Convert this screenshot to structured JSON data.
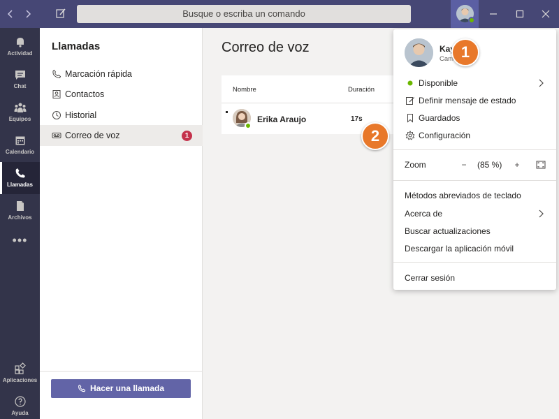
{
  "titlebar": {
    "search_placeholder": "Busque o escriba un comando",
    "back_icon": "chevron-left-icon",
    "forward_icon": "chevron-right-icon",
    "compose_icon": "compose-icon"
  },
  "rail": {
    "items": [
      {
        "label": "Actividad",
        "icon": "bell-icon"
      },
      {
        "label": "Chat",
        "icon": "chat-icon"
      },
      {
        "label": "Equipos",
        "icon": "teams-icon"
      },
      {
        "label": "Calendario",
        "icon": "calendar-icon"
      },
      {
        "label": "Llamadas",
        "icon": "phone-icon",
        "active": true
      },
      {
        "label": "Archivos",
        "icon": "file-icon"
      }
    ],
    "more": "•••",
    "apps_label": "Aplicaciones",
    "help_label": "Ayuda"
  },
  "panel": {
    "title": "Llamadas",
    "items": [
      {
        "label": "Marcación rápida",
        "icon": "phone-icon"
      },
      {
        "label": "Contactos",
        "icon": "contacts-icon"
      },
      {
        "label": "Historial",
        "icon": "clock-icon"
      },
      {
        "label": "Correo de voz",
        "icon": "voicemail-icon",
        "badge": "1",
        "selected": true
      }
    ],
    "call_button": "Hacer una llamada"
  },
  "main": {
    "title": "Correo de voz",
    "columns": [
      "Nombre",
      "Duración"
    ],
    "rows": [
      {
        "name": "Erika Araujo",
        "duration": "17s",
        "status": "available"
      }
    ]
  },
  "profile_menu": {
    "name": "Kay   pool",
    "subtitle": "Cam         agen",
    "status": "Disponible",
    "status_color": "#6bb700",
    "items_top": [
      {
        "label": "Definir mensaje de estado",
        "icon": "edit-icon"
      },
      {
        "label": "Guardados",
        "icon": "bookmark-icon"
      },
      {
        "label": "Configuración",
        "icon": "gear-icon"
      }
    ],
    "zoom_label": "Zoom",
    "zoom_minus": "−",
    "zoom_value": "(85 %)",
    "zoom_plus": "+",
    "items_bottom": [
      "Métodos abreviados de teclado",
      "Acerca de",
      "Buscar actualizaciones",
      "Descargar la aplicación móvil"
    ],
    "signout": "Cerrar sesión"
  },
  "callouts": [
    "1",
    "2"
  ],
  "colors": {
    "titlebar": "#464775",
    "rail": "#33344a",
    "accent": "#6264a7",
    "callout": "#e8782a",
    "badge": "#c4314b"
  }
}
